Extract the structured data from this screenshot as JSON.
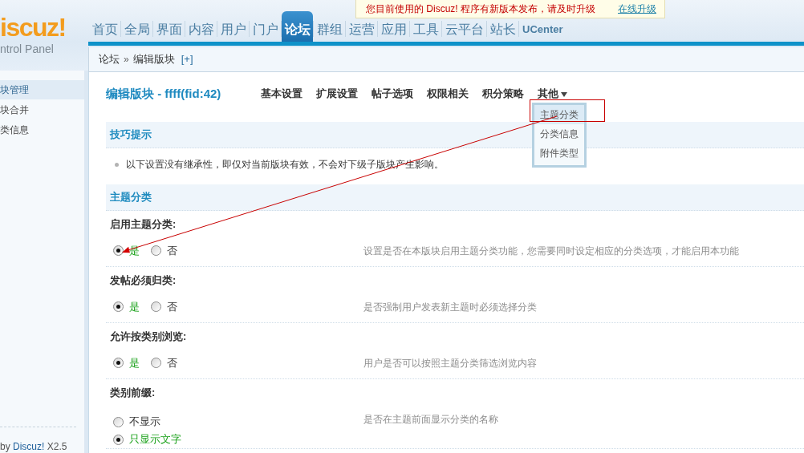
{
  "logo": {
    "title": "iscuz!",
    "subtitle": "ntrol Panel"
  },
  "notice": {
    "message": "您目前使用的 Discuz! 程序有新版本发布，请及时升级",
    "link": "在线升级"
  },
  "nav_tabs": [
    {
      "label": "首页",
      "kind": "module",
      "selected": false
    },
    {
      "label": "全局",
      "kind": "module",
      "selected": false
    },
    {
      "label": "界面",
      "kind": "module",
      "selected": false
    },
    {
      "label": "内容",
      "kind": "module",
      "selected": false
    },
    {
      "label": "用户",
      "kind": "module",
      "selected": false
    },
    {
      "label": "门户",
      "kind": "module",
      "selected": false
    },
    {
      "label": "论坛",
      "kind": "module",
      "selected": true
    },
    {
      "label": "群组",
      "kind": "module",
      "selected": false
    },
    {
      "label": "运营",
      "kind": "module",
      "selected": false
    },
    {
      "label": "应用",
      "kind": "module",
      "selected": false
    },
    {
      "label": "工具",
      "kind": "module",
      "selected": false
    },
    {
      "label": "云平台",
      "kind": "module",
      "selected": false
    },
    {
      "label": "站长",
      "kind": "module",
      "selected": false
    },
    {
      "label": "UCenter",
      "kind": "app",
      "selected": false
    }
  ],
  "breadcrumb": {
    "items": [
      "论坛",
      "编辑版块"
    ],
    "separator": "»",
    "toggle": "[+]"
  },
  "sidebar": {
    "items": [
      {
        "label": "块管理",
        "selected": true
      },
      {
        "label": "块合并",
        "selected": false
      },
      {
        "label": "类信息",
        "selected": false
      }
    ],
    "footer": {
      "prefix": "by",
      "link": "Discuz!",
      "suffix": "X2.5"
    }
  },
  "page": {
    "title": "编辑版块 - ffff(fid:42)",
    "tabs": [
      {
        "label": "基本设置",
        "kind": "link"
      },
      {
        "label": "扩展设置",
        "kind": "link"
      },
      {
        "label": "帖子选项",
        "kind": "link"
      },
      {
        "label": "权限相关",
        "kind": "link"
      },
      {
        "label": "积分策略",
        "kind": "link"
      },
      {
        "label": "其他",
        "kind": "dropdown",
        "expanded": true,
        "items": [
          {
            "label": "主题分类",
            "selected": true
          },
          {
            "label": "分类信息",
            "selected": false
          },
          {
            "label": "附件类型",
            "selected": false
          }
        ]
      }
    ]
  },
  "sections": [
    {
      "title": "技巧提示",
      "kind": "tips",
      "tips": [
        "以下设置没有继承性，即仅对当前版块有效，不会对下级子版块产生影响。"
      ]
    },
    {
      "title": "主题分类",
      "kind": "settings",
      "settings": [
        {
          "label": "启用主题分类:",
          "kind": "inline",
          "options": [
            {
              "label": "是",
              "selected": true
            },
            {
              "label": "否",
              "selected": false
            }
          ],
          "description": "设置是否在本版块启用主题分类功能，您需要同时设定相应的分类选项，才能启用本功能"
        },
        {
          "label": "发帖必须归类:",
          "kind": "inline",
          "options": [
            {
              "label": "是",
              "selected": true
            },
            {
              "label": "否",
              "selected": false
            }
          ],
          "description": "是否强制用户发表新主题时必须选择分类"
        },
        {
          "label": "允许按类别浏览:",
          "kind": "inline",
          "options": [
            {
              "label": "是",
              "selected": true
            },
            {
              "label": "否",
              "selected": false
            }
          ],
          "description": "用户是否可以按照主题分类筛选浏览内容"
        },
        {
          "label": "类别前缀:",
          "kind": "list",
          "options": [
            {
              "label": "不显示",
              "selected": false
            },
            {
              "label": "只显示文字",
              "selected": true
            }
          ],
          "description": "是否在主题前面显示分类的名称"
        }
      ]
    }
  ]
}
